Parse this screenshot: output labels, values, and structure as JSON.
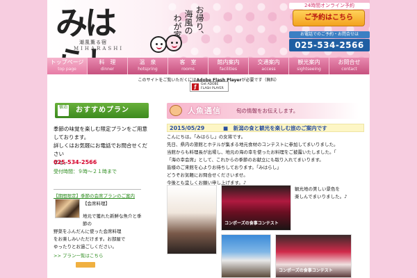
{
  "header": {
    "logo_text": "みはらし",
    "logo_sub": "潮風薫る宿",
    "logo_en": "MIHARASHI",
    "catch_1": "お帰り、",
    "catch_2": "海風の",
    "catch_3": "わが家へ",
    "reserve_top": "24時間オンライン予約",
    "reserve_button": "ご予約はこちら",
    "tel_label": "お電話でのご予約・お問合せは",
    "tel_number": "025-534-2566"
  },
  "nav": [
    {
      "ja": "トップページ",
      "en": "top page"
    },
    {
      "ja": "料　理",
      "en": "dinner"
    },
    {
      "ja": "温　泉",
      "en": "hotspring"
    },
    {
      "ja": "客　室",
      "en": "rooms"
    },
    {
      "ja": "館内案内",
      "en": "facilities"
    },
    {
      "ja": "交通案内",
      "en": "access"
    },
    {
      "ja": "観光案内",
      "en": "sightseeing"
    },
    {
      "ja": "お問合せ",
      "en": "contact"
    }
  ],
  "flash": {
    "note_before": "このサイトをご覧いただくには",
    "note_strong": "Adobe Flash Player",
    "note_after": "が必要です（無料）",
    "badge_line1": "Get ADOBE",
    "badge_line2": "FLASH PLAYER"
  },
  "recommend": {
    "title": "おすすめプラン",
    "icon_text": "宿泊",
    "text_line1": "季節の味覚を楽しむ限定プランをご用意",
    "text_line2": "しております。",
    "text_line3": "詳しくはお気軽にお電話でお問合せください",
    "text_line4": "ませ。",
    "tel": "025-534-2566",
    "green_note": "受付時間：９時〜２１時まで",
    "link": "【期間限定】季節の会席プランのご案内",
    "item_title": "【会席料理】",
    "desc_line1": "地元で獲れた新鮮な魚介と季節の",
    "desc_line2": "野菜をふんだんに使った会席料理",
    "desc_line3": "をお楽しみいただけます。お部屋で",
    "desc_line4": "ゆったりとお過ごしください。",
    "more": ">> プラン一覧はこちら"
  },
  "news": {
    "title": "人魚通信",
    "subtitle": "旬の情報をお伝えします。",
    "date": "2015/05/29",
    "headline": "■　新潟の食と観光を楽しむ旅のご案内です",
    "lines": [
      "こんにちは。「みはらし」の女将です。",
      "先日、県内の旅館とホテルが集まる地元食材のコンテストに参加してまいりました。",
      "当館からも料理長が出場し、地元の海の幸を使ったお料理をご披露いたしました。「",
      "「海の幸会席」として、これからの季節のお献立にも取り入れてまいります。",
      "皆様のご来館を心よりお待ちしております。「みはらし」",
      "どうぞお気軽にお問合せくださいませ。",
      "今後とも宜しくお願い申し上げます。♪"
    ],
    "photo_caption_1": "コンポーズの食事コンテスト",
    "photo_caption_2": "コンポーズの食事コンテスト",
    "side_caption_1": "観光地の美しい景色を",
    "side_caption_2": "楽しんでまいりました。♪"
  },
  "colors": {
    "pink_bg": "#f7cde0",
    "nav_pink": "#c7517f",
    "green": "#3c8a1f",
    "tel_blue": "#1f5fa3",
    "date_blue": "#2a4f9e",
    "reserve_orange": "#f3a21f"
  }
}
